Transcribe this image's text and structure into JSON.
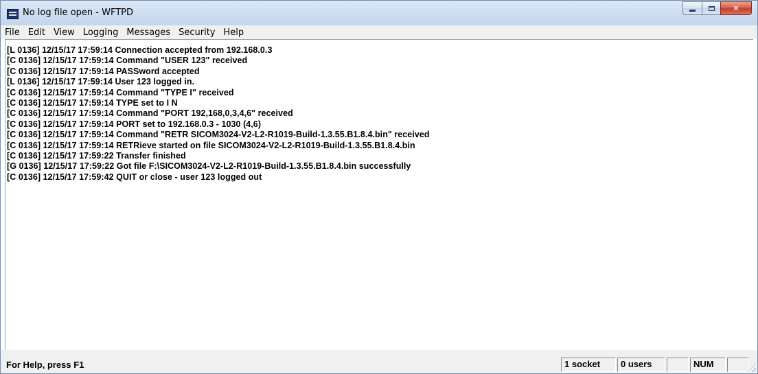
{
  "window": {
    "title": "No log file open - WFTPD"
  },
  "menu": [
    "File",
    "Edit",
    "View",
    "Logging",
    "Messages",
    "Security",
    "Help"
  ],
  "log": [
    "[L 0136] 12/15/17 17:59:14 Connection accepted from 192.168.0.3",
    "[C 0136] 12/15/17 17:59:14 Command \"USER 123\" received",
    "[C 0136] 12/15/17 17:59:14 PASSword accepted",
    "[L 0136] 12/15/17 17:59:14 User 123 logged in.",
    "[C 0136] 12/15/17 17:59:14 Command \"TYPE I\" received",
    "[C 0136] 12/15/17 17:59:14 TYPE set to I N",
    "[C 0136] 12/15/17 17:59:14 Command \"PORT 192,168,0,3,4,6\" received",
    "[C 0136] 12/15/17 17:59:14 PORT set to 192.168.0.3 - 1030 (4,6)",
    "[C 0136] 12/15/17 17:59:14 Command \"RETR SICOM3024-V2-L2-R1019-Build-1.3.55.B1.8.4.bin\" received",
    "[C 0136] 12/15/17 17:59:14 RETRieve started on file SICOM3024-V2-L2-R1019-Build-1.3.55.B1.8.4.bin",
    "[C 0136] 12/15/17 17:59:22 Transfer finished",
    "[G 0136] 12/15/17 17:59:22 Got file F:\\SICOM3024-V2-L2-R1019-Build-1.3.55.B1.8.4.bin successfully",
    "[C 0136] 12/15/17 17:59:42 QUIT or close - user 123 logged out"
  ],
  "status": {
    "help": "For Help, press F1",
    "sockets": "1 socket",
    "users": "0 users",
    "blank": "",
    "num": "NUM",
    "last": ""
  },
  "icons": {
    "app": "wftpd-app-icon",
    "minimize": "minimize-icon",
    "maximize": "maximize-icon",
    "close": "close-icon",
    "grip": "resize-grip-icon"
  }
}
